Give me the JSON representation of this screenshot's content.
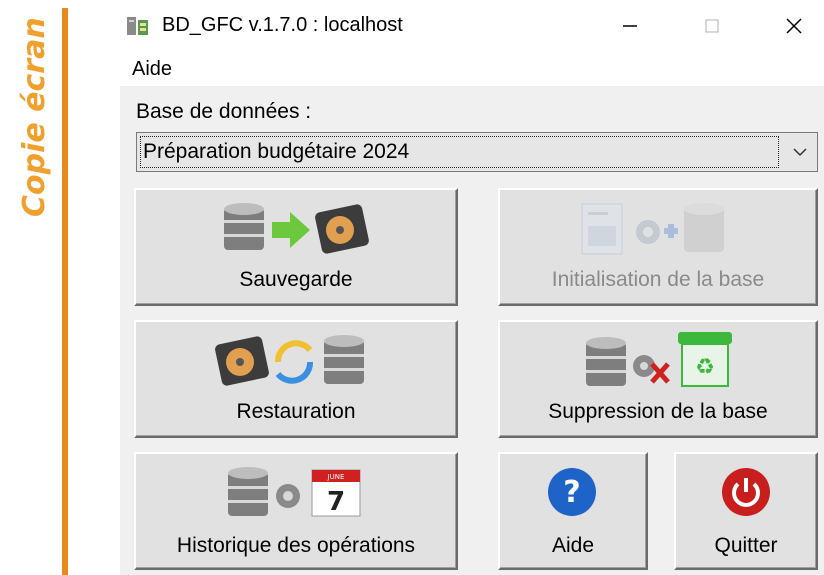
{
  "side_label": "Copie écran",
  "window": {
    "title": "BD_GFC v.1.7.0 : localhost"
  },
  "menu": {
    "aide": "Aide"
  },
  "database": {
    "label": "Base de données :",
    "selected": "Préparation budgétaire 2024"
  },
  "buttons": {
    "sauvegarde": "Sauvegarde",
    "initialisation": "Initialisation de la base",
    "restauration": "Restauration",
    "suppression": "Suppression de la base",
    "historique": "Historique des opérations",
    "aide": "Aide",
    "quitter": "Quitter"
  },
  "calendar": {
    "month": "JUNE",
    "day": "7"
  },
  "colors": {
    "accent_bar": "#e8891c",
    "help_blue": "#1e64c8",
    "quit_red": "#c81e1e",
    "arrow_green": "#6cc83c"
  }
}
